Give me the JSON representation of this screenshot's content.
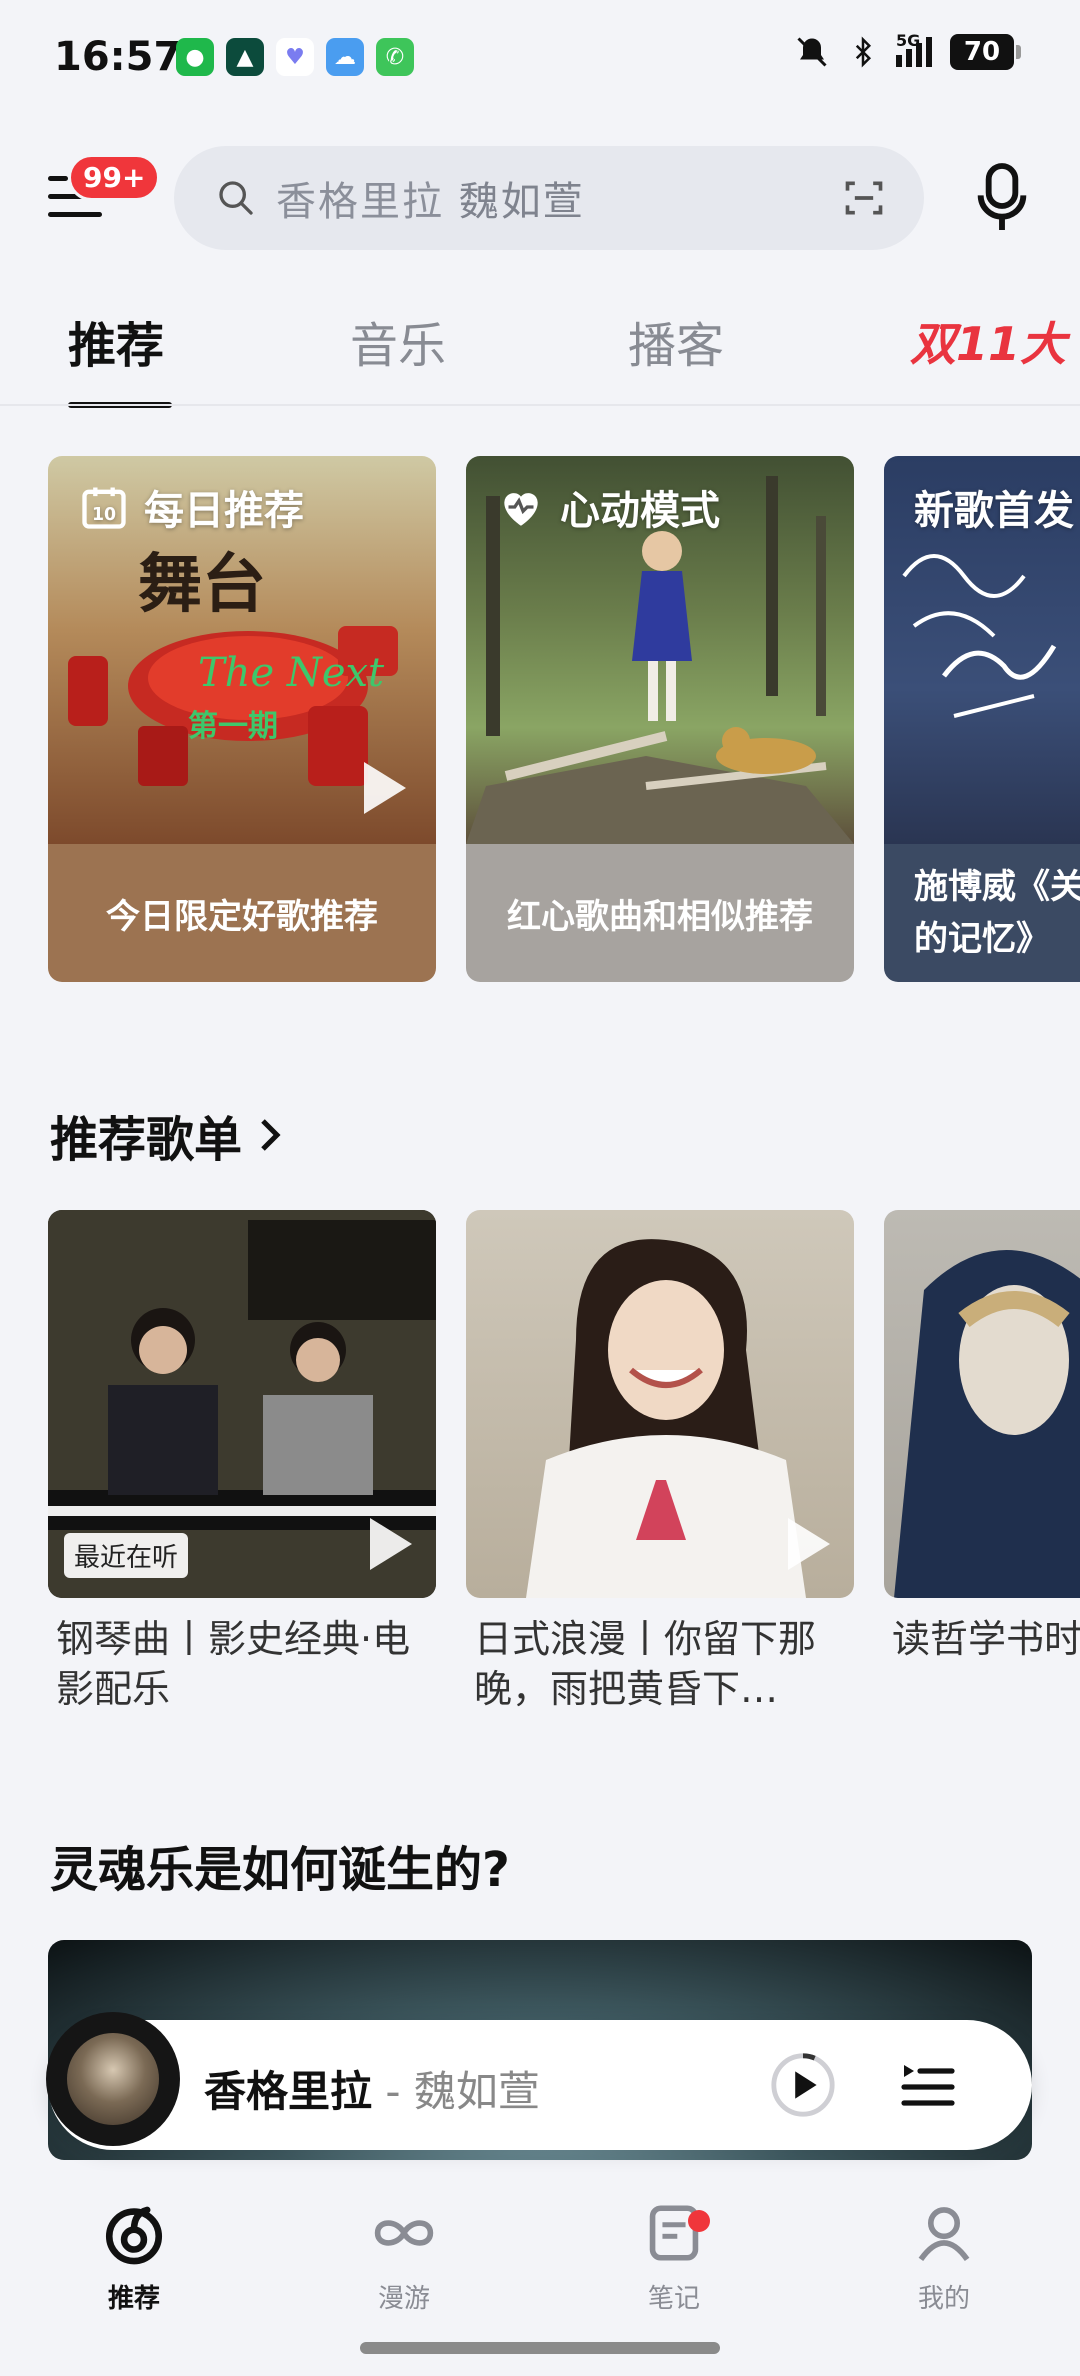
{
  "status_bar": {
    "time": "16:57",
    "network": "5G",
    "battery": "70",
    "app_icons": [
      "wechat-icon",
      "green-app-icon",
      "heart-app-icon",
      "weather-icon",
      "phone-icon"
    ]
  },
  "header": {
    "badge": "99+",
    "search_song": "香格里拉",
    "search_artist": "魏如萱"
  },
  "tabs": {
    "items": [
      "推荐",
      "音乐",
      "播客"
    ],
    "active": "推荐",
    "promo": "双11大"
  },
  "feature_cards": [
    {
      "header": "每日推荐",
      "calendar_day": "10",
      "caption": "今日限定好歌推荐",
      "bottom_color": "#9c7351"
    },
    {
      "header": "心动模式",
      "caption": "红心歌曲和相似推荐",
      "bottom_color": "#a7a39f"
    },
    {
      "header": "新歌首发",
      "caption_line1": "施博威《关",
      "caption_line2": "的记忆》",
      "bottom_color": "#3b4a63"
    }
  ],
  "playlists_section": {
    "title": "推荐歌单",
    "items": [
      {
        "title": "钢琴曲丨影史经典·电影配乐",
        "tag": "最近在听"
      },
      {
        "title": "日式浪漫丨你留下那晚，雨把黄昏下…"
      },
      {
        "title": "读哲学书时曲子"
      }
    ]
  },
  "soul_section": {
    "title": "灵魂乐是如何诞生的?"
  },
  "mini_player": {
    "song": "香格里拉",
    "separator": " - ",
    "artist": "魏如萱"
  },
  "bottom_nav": [
    {
      "label": "推荐",
      "icon": "netease-logo-icon",
      "active": true
    },
    {
      "label": "漫游",
      "icon": "infinity-icon",
      "active": false
    },
    {
      "label": "笔记",
      "icon": "note-icon",
      "active": false
    },
    {
      "label": "我的",
      "icon": "profile-icon",
      "active": false
    }
  ],
  "colors": {
    "accent_red": "#f0363b",
    "background": "#f3f4f8"
  }
}
